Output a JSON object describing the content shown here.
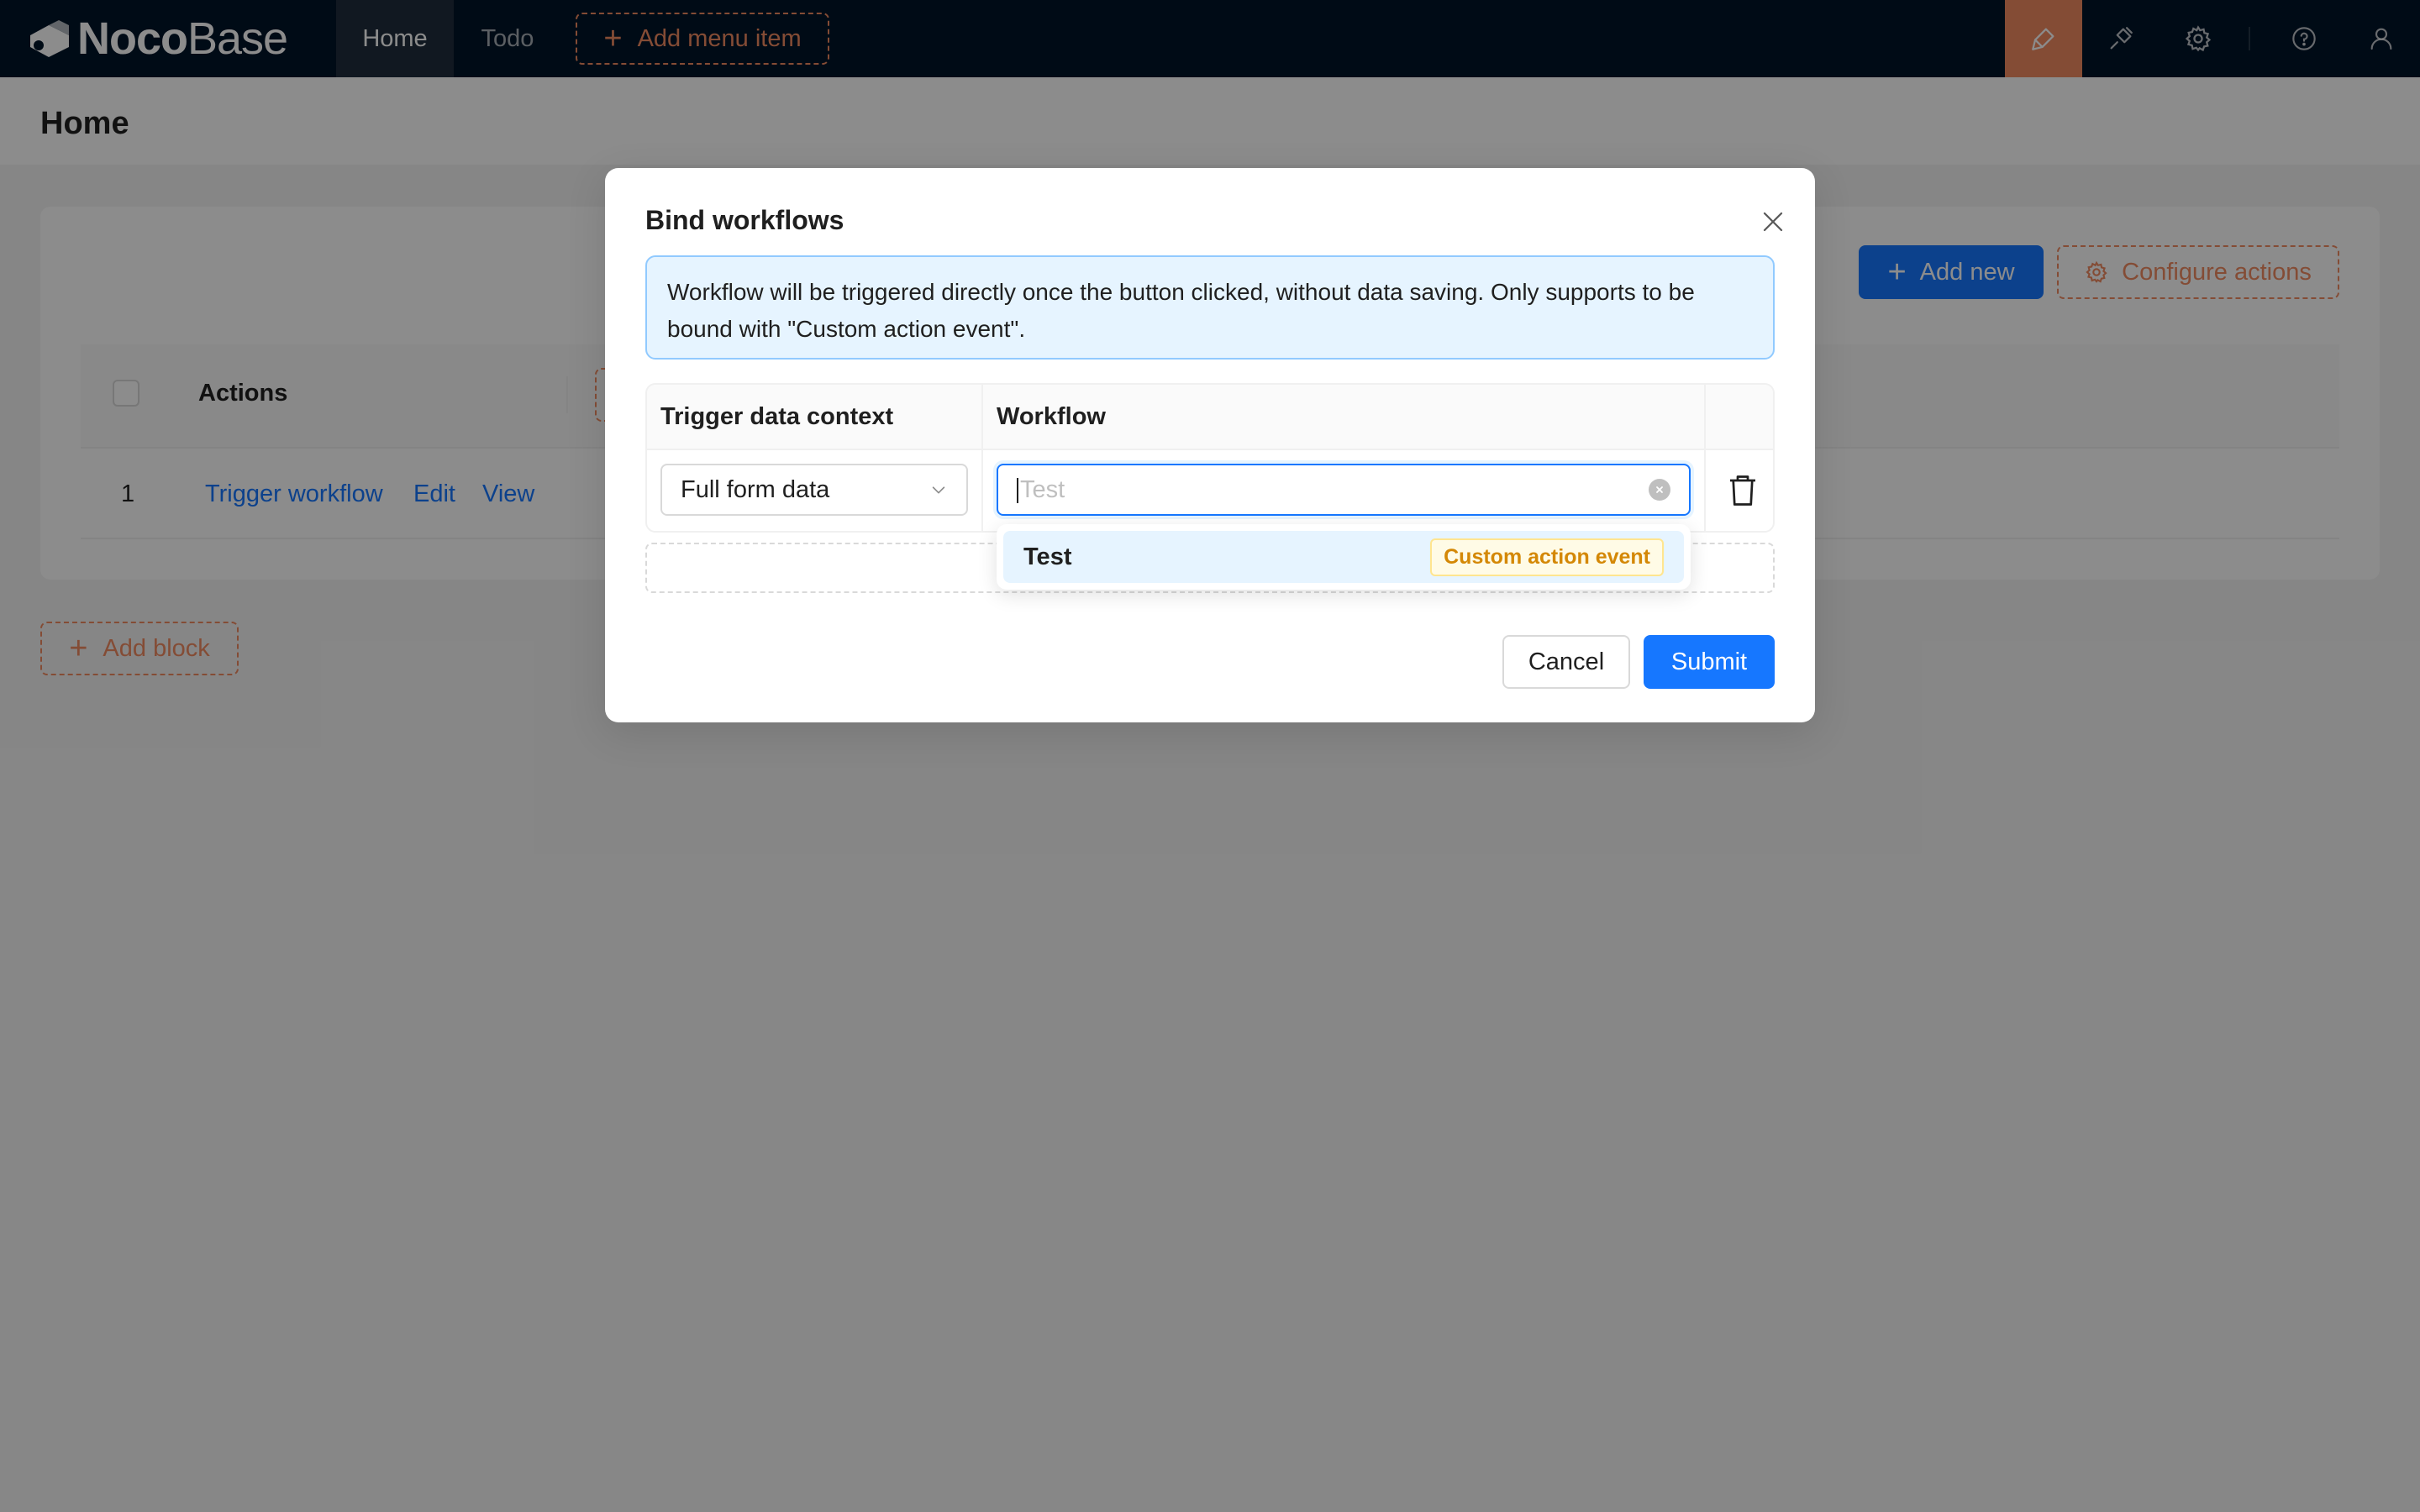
{
  "app": {
    "logo_noco": "Noco",
    "logo_base": "Base",
    "nav": [
      {
        "label": "Home",
        "active": true
      },
      {
        "label": "Todo",
        "active": false
      }
    ],
    "add_menu_label": "Add menu item",
    "toolbar_icons": [
      "brush-icon",
      "plugin-icon",
      "gear-icon",
      "help-icon",
      "user-icon"
    ]
  },
  "page": {
    "title": "Home",
    "add_new_label": "Add new",
    "configure_actions_label": "Configure actions",
    "table": {
      "columns": [
        "Actions"
      ],
      "rows": [
        {
          "index": "1",
          "links": [
            "Trigger workflow",
            "Edit",
            "View"
          ]
        }
      ]
    },
    "add_block_label": "Add block"
  },
  "modal": {
    "title": "Bind workflows",
    "alert": "Workflow will be triggered directly once the button clicked, without data saving. Only supports to be bound with \"Custom action event\".",
    "columns": [
      "Trigger data context",
      "Workflow"
    ],
    "row": {
      "context_value": "Full form data",
      "workflow_placeholder": "Test"
    },
    "dropdown": {
      "options": [
        {
          "label": "Test",
          "tag": "Custom action event"
        }
      ]
    },
    "cancel_label": "Cancel",
    "submit_label": "Submit"
  },
  "colors": {
    "nav_bg": "#001529",
    "primary": "#1677ff",
    "accent": "#f18b62",
    "tag_text": "#d48806"
  }
}
